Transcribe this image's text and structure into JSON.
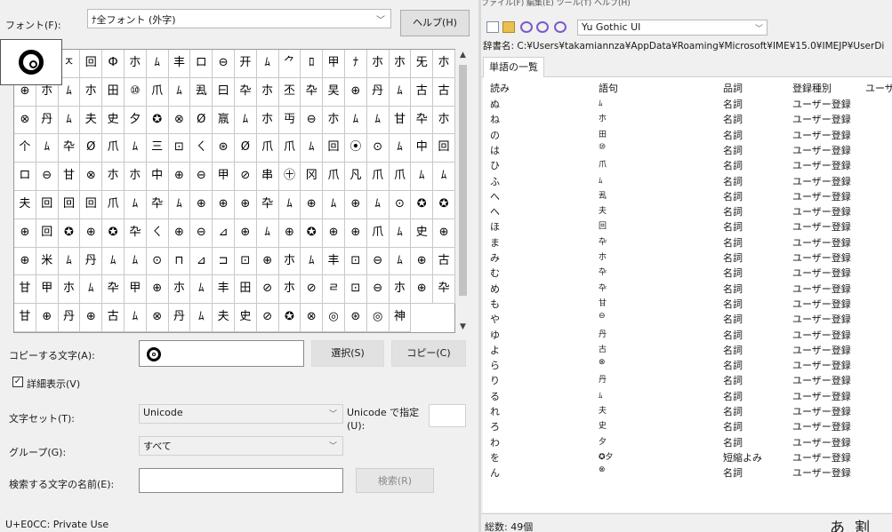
{
  "charmap": {
    "font_label": "フォント(F):",
    "font_value": "ﾅ全フォント (外字)",
    "help_button": "ヘルプ(H)",
    "copy_label": "コピーする文字(A):",
    "select_button": "選択(S)",
    "copy_button": "コピー(C)",
    "details_label": "詳細表示(V)",
    "details_checked": "✓",
    "charset_label": "文字セット(T):",
    "charset_value": "Unicode",
    "unicode_goto_label": "Unicode で指定 (U):",
    "group_label": "グループ(G):",
    "group_value": "すべて",
    "search_label": "検索する文字の名前(E):",
    "search_button": "検索(R)",
    "status": "U+E0CC: Private Use",
    "grid_rows": [
      "ﾅ◬ㅈ回Ф朩ﾑ丰ロ⊖开ﾑ⺈ﾛ甲ﾅ朩朩旡朩",
      "⊕朩ﾑ朩田⑩爪ﾑ厾曰卆朩丕卆旲⊕丹ﾑ古古",
      "⊗丹ﾑ夫史夕✪⊗Ø𣎆ﾑ朩丏⊖朩ﾑﾑ甘卆朩",
      "个ﾑ卆Ø爪ﾑ三⊡ㄑ⊛Ø爪爪ﾑ回⦿⊙ﾑ中回",
      "ロ⊖甘⊗朩朩中⊕⊖甲⊘串㊉冈爪凡爪爪ﾑ",
      "ﾑ夫回回回爪ﾑ卆ﾑ⊕⊕⊕卆ﾑ⊕ﾑ⊕ﾑ⊙✪",
      "✪⊕回✪⊕✪卆ㄑ⊕⊖⊿⊕ﾑ⊕✪⊕⊕爪ﾑ",
      "史⊕⊕米ﾑ丹ﾑﾑ⊙⊓⊿⊐⊡⊕朩ﾑ丰⊡⊖ﾑ",
      "⊕古甘甲朩ﾑ卆甲⊕朩ﾑ丰田⊘朩⊘ㄹ⊡⊖朩",
      "⊕卆甘⊕丹⊕古ﾑ⊗丹ﾑ夫史⊘✪⊗◎⊛◎神"
    ]
  },
  "dict": {
    "menubar": "ファイル(F)  編集(E)  ツール(T)  ヘルプ(H)",
    "toolbar_font": "Yu Gothic UI",
    "dict_path": "辞書名: C:¥Users¥takamiannza¥AppData¥Roaming¥Microsoft¥IME¥15.0¥IMEJP¥UserDi",
    "tab": "単語の一覧",
    "columns": [
      "読み",
      "語句",
      "品詞",
      "登録種別",
      "ユーザー"
    ],
    "rows": [
      {
        "yomi": "ぬ",
        "goku": "ﾑ",
        "hinshi": "名詞",
        "shubetsu": "ユーザー登録"
      },
      {
        "yomi": "ね",
        "goku": "朩",
        "hinshi": "名詞",
        "shubetsu": "ユーザー登録"
      },
      {
        "yomi": "の",
        "goku": "田",
        "hinshi": "名詞",
        "shubetsu": "ユーザー登録"
      },
      {
        "yomi": "は",
        "goku": "⑩",
        "hinshi": "名詞",
        "shubetsu": "ユーザー登録"
      },
      {
        "yomi": "ひ",
        "goku": "爪",
        "hinshi": "名詞",
        "shubetsu": "ユーザー登録"
      },
      {
        "yomi": "ふ",
        "goku": "ﾑ",
        "hinshi": "名詞",
        "shubetsu": "ユーザー登録"
      },
      {
        "yomi": "へ",
        "goku": "厾",
        "hinshi": "名詞",
        "shubetsu": "ユーザー登録"
      },
      {
        "yomi": "へ",
        "goku": "夫",
        "hinshi": "名詞",
        "shubetsu": "ユーザー登録"
      },
      {
        "yomi": "ほ",
        "goku": "回",
        "hinshi": "名詞",
        "shubetsu": "ユーザー登録"
      },
      {
        "yomi": "ま",
        "goku": "卆",
        "hinshi": "名詞",
        "shubetsu": "ユーザー登録"
      },
      {
        "yomi": "み",
        "goku": "朩",
        "hinshi": "名詞",
        "shubetsu": "ユーザー登録"
      },
      {
        "yomi": "む",
        "goku": "卆",
        "hinshi": "名詞",
        "shubetsu": "ユーザー登録"
      },
      {
        "yomi": "め",
        "goku": "卆",
        "hinshi": "名詞",
        "shubetsu": "ユーザー登録"
      },
      {
        "yomi": "も",
        "goku": "甘",
        "hinshi": "名詞",
        "shubetsu": "ユーザー登録"
      },
      {
        "yomi": "や",
        "goku": "⊖",
        "hinshi": "名詞",
        "shubetsu": "ユーザー登録"
      },
      {
        "yomi": "ゆ",
        "goku": "丹",
        "hinshi": "名詞",
        "shubetsu": "ユーザー登録"
      },
      {
        "yomi": "よ",
        "goku": "古",
        "hinshi": "名詞",
        "shubetsu": "ユーザー登録"
      },
      {
        "yomi": "ら",
        "goku": "⊗",
        "hinshi": "名詞",
        "shubetsu": "ユーザー登録"
      },
      {
        "yomi": "り",
        "goku": "丹",
        "hinshi": "名詞",
        "shubetsu": "ユーザー登録"
      },
      {
        "yomi": "る",
        "goku": "ﾑ",
        "hinshi": "名詞",
        "shubetsu": "ユーザー登録"
      },
      {
        "yomi": "れ",
        "goku": "夫",
        "hinshi": "名詞",
        "shubetsu": "ユーザー登録"
      },
      {
        "yomi": "ろ",
        "goku": "史",
        "hinshi": "名詞",
        "shubetsu": "ユーザー登録"
      },
      {
        "yomi": "わ",
        "goku": "夕",
        "hinshi": "名詞",
        "shubetsu": "ユーザー登録"
      },
      {
        "yomi": "を",
        "goku": "✪夕",
        "hinshi": "短縮よみ",
        "shubetsu": "ユーザー登録"
      },
      {
        "yomi": "ん",
        "goku": "⊗",
        "hinshi": "名詞",
        "shubetsu": "ユーザー登録"
      }
    ],
    "status": "総数: 49個",
    "ime_mode": "あ",
    "ime_tool": "割"
  },
  "colors": {
    "panel": "#f0f0f0",
    "grid_line": "#c8c8c8"
  }
}
